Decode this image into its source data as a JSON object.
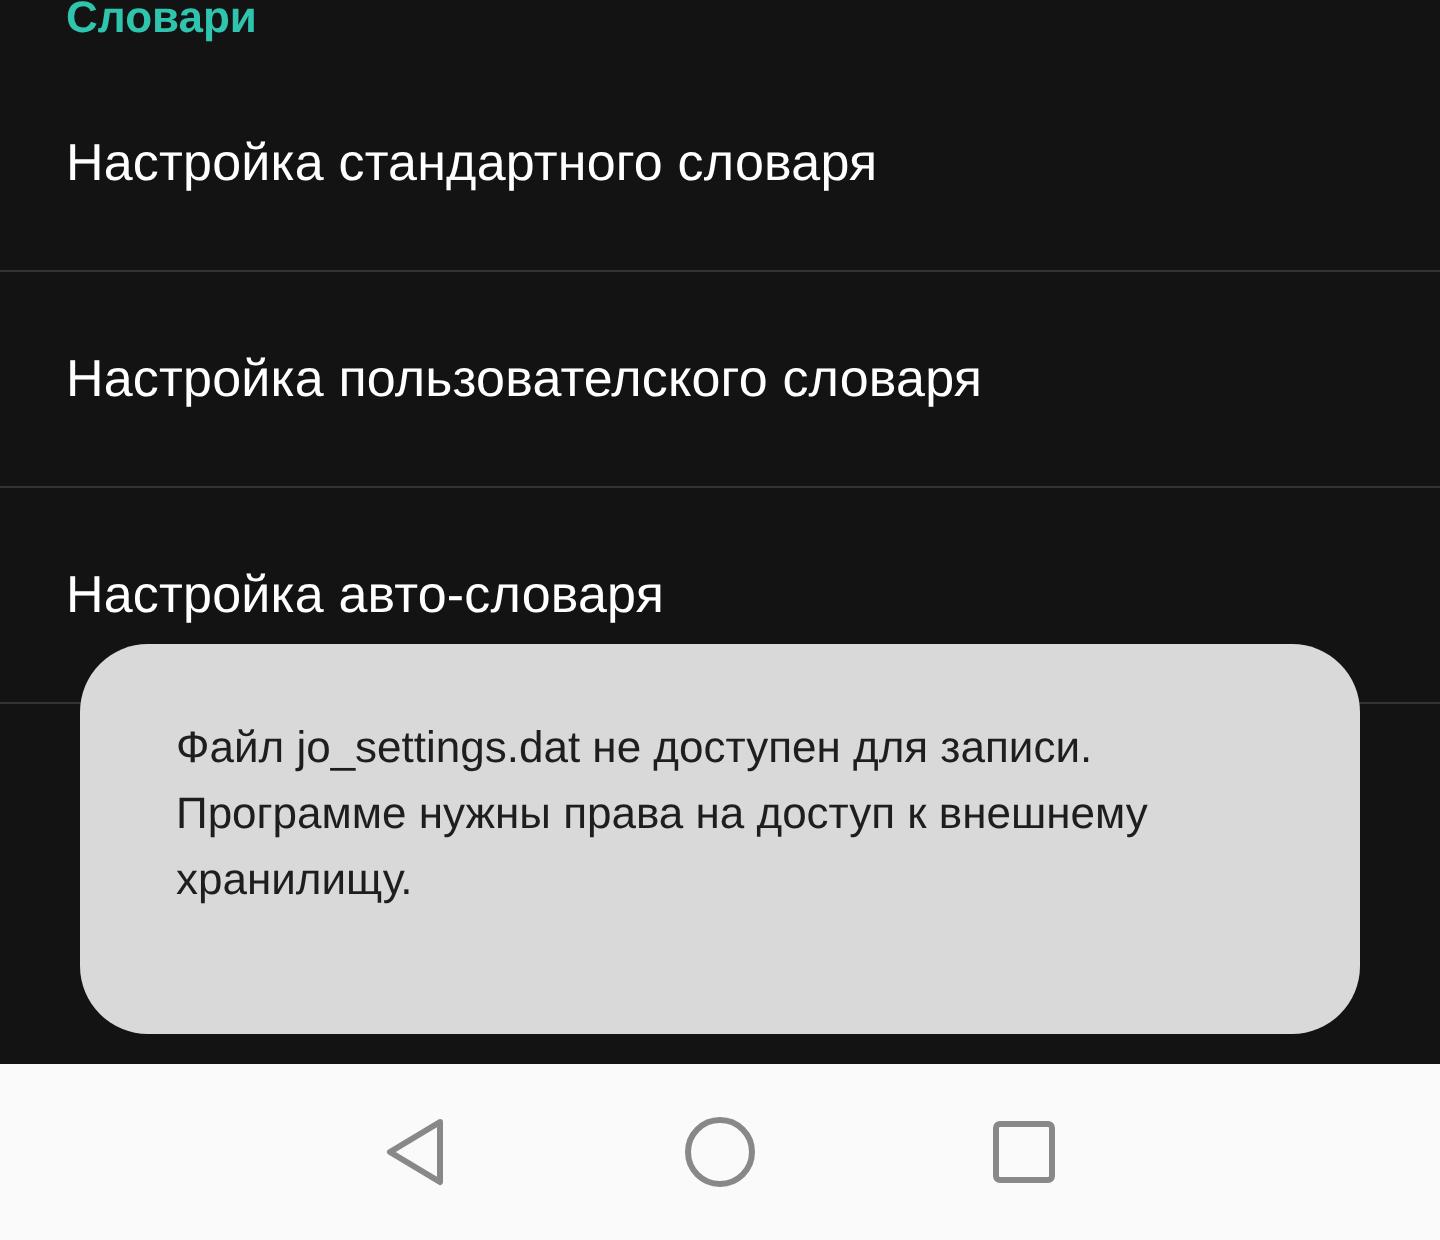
{
  "section_header": "Словари",
  "items": [
    {
      "title": "Настройка стандартного словаря"
    },
    {
      "title": "Настройка пользователского словаря"
    },
    {
      "title": "Настройка авто-словаря"
    }
  ],
  "toast": {
    "messages": [
      "Файл jo_settings.dat не доступен для записи.",
      "Программе нужны права на доступ к внешнему хранилищу."
    ]
  }
}
